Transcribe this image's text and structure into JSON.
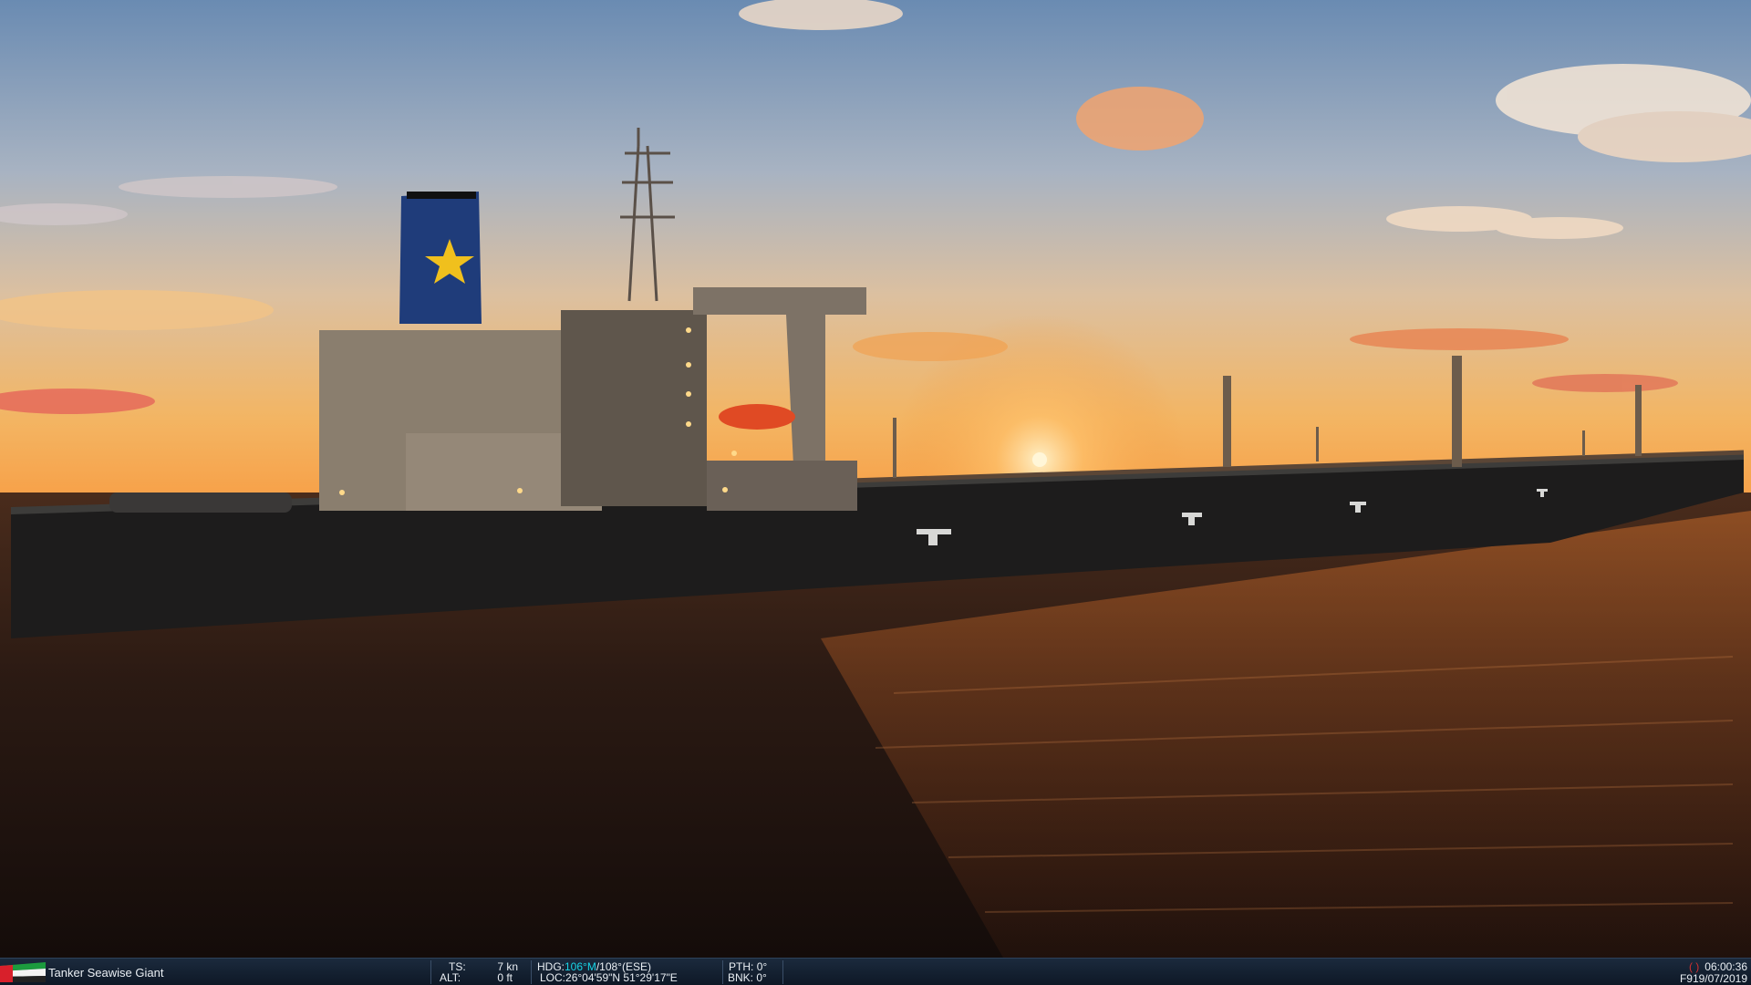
{
  "scene": {
    "title": "Tanker Seawise Giant",
    "colors": {
      "sky_top": "#6e8fb5",
      "sky_mid": "#c9b8b0",
      "sky_horizon": "#f1b05e",
      "sun": "#ffe8b0",
      "water": "#2a1a14",
      "hull": "#1c1b1b",
      "superstructure": "#8a7e6f",
      "funnel": "#1e3d7a",
      "funnel_star": "#f2c31d",
      "lifeboat": "#e24a24"
    }
  },
  "status_bar": {
    "flag_icon": "uae-flag-icon",
    "vehicle_name": "Tanker Seawise Giant",
    "ts_label": "TS:",
    "ts_value": "7 kn",
    "alt_label": "ALT:",
    "alt_value": "0 ft",
    "hdg_label": "HDG:",
    "hdg_mag": "106°M",
    "hdg_true": "/108°(ESE)",
    "loc_label": "LOC:",
    "loc_value": "26°04'59\"N 51°29'17\"E",
    "pth_label": "PTH:",
    "pth_value": "0°",
    "bnk_label": "BNK:",
    "bnk_value": "0°",
    "rec_indicator": "( )",
    "time": "06:00:36",
    "date": "F919/07/2019"
  }
}
